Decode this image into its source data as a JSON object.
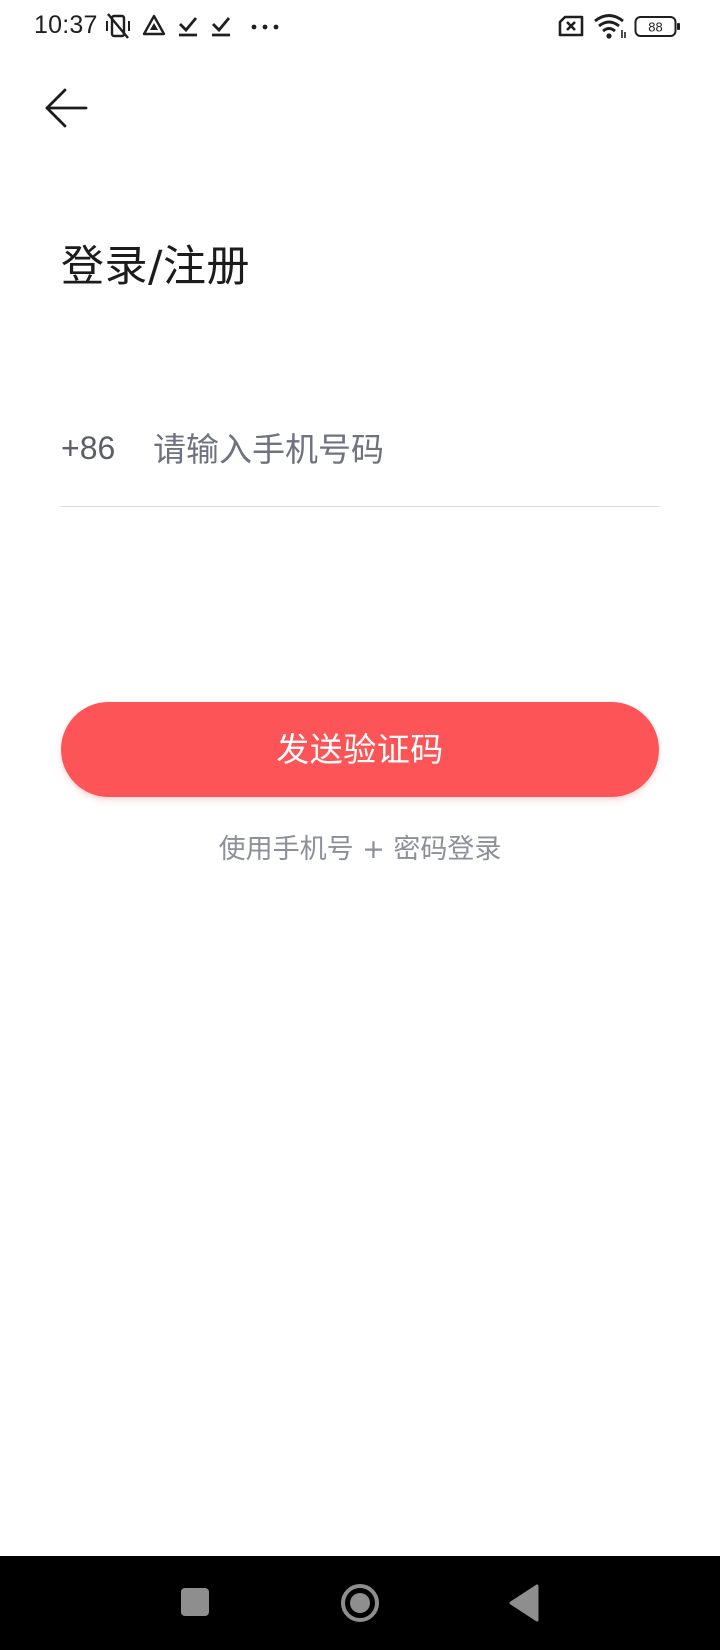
{
  "status_bar": {
    "time": "10:37",
    "battery_level": "88",
    "icons": [
      "vibrate-off-icon",
      "navigation-icon",
      "download-done-icon",
      "download-done-icon",
      "more-dots-icon",
      "sim-off-icon",
      "wifi-icon",
      "battery-icon"
    ]
  },
  "header": {
    "back_icon": "arrow-left-icon"
  },
  "main": {
    "title": "登录/注册",
    "country_code": "+86",
    "phone_placeholder": "请输入手机号码",
    "phone_value": "",
    "send_code_label": "发送验证码",
    "alt_login_label": "使用手机号 + 密码登录"
  },
  "nav_bar": {
    "buttons": [
      "recents-square-icon",
      "home-circle-icon",
      "back-triangle-icon"
    ]
  },
  "colors": {
    "accent": "#fd5557",
    "placeholder": "#6f7280",
    "secondary_text": "#8d8f99",
    "divider": "#dcdcde"
  }
}
